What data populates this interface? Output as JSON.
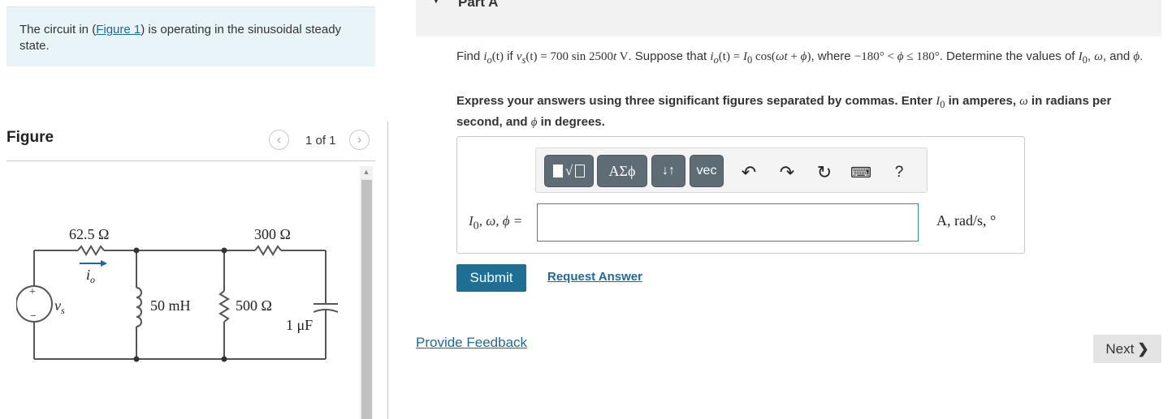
{
  "intro": {
    "text_before": "The circuit in (",
    "figure_link": "Figure 1",
    "text_after": ") is operating in the sinusoidal steady state."
  },
  "figure": {
    "label": "Figure",
    "pager": "1 of 1",
    "prev_icon": "chevron-left",
    "next_icon": "chevron-right"
  },
  "circuit": {
    "r1": "62.5 Ω",
    "r2": "300 Ω",
    "inductor": "50 mH",
    "r3": "500 Ω",
    "capacitor": "1 μF",
    "source_label": "v",
    "source_sub": "s",
    "current_label": "i",
    "current_sub": "o",
    "plus": "+",
    "minus": "−"
  },
  "part": {
    "title": "Part A"
  },
  "question": {
    "find": "Find ",
    "io": "i",
    "io_sub": "o",
    "t_paren": "(t)",
    "if": " if ",
    "vs": "v",
    "vs_sub": "s",
    "eq_value": " = 700 sin 2500",
    "t": "t",
    "unit": " V",
    "suppose": ". Suppose that ",
    "eq_io": " = ",
    "I0": "I",
    "I0_sub": "0",
    "cos": " cos(",
    "omega_t": "ωt",
    "plus_phi": " + ",
    "phi": "ϕ",
    "close": ")",
    "where": ", where ",
    "range": "−180° < ",
    "range2": " ≤ 180°",
    "determine": ". Determine the values of ",
    "comma1": ", ",
    "omega": "ω",
    "and": ", and ",
    "end": "."
  },
  "instructions": {
    "part1": "Express your answers using three significant figures separated by commas. Enter ",
    "I0": "I",
    "I0_sub": "0",
    "part2": " in amperes, ",
    "omega": "ω",
    "part3": " in radians per second, and ",
    "phi": "ϕ",
    "part4": " in degrees."
  },
  "toolbar": {
    "greek": "ΑΣϕ",
    "subsup": "↓↑",
    "vec": "vec",
    "undo_icon": "undo",
    "redo_icon": "redo",
    "reset_icon": "reset",
    "keyboard_icon": "keyboard",
    "help": "?"
  },
  "answer": {
    "label_I": "I",
    "label_sub": "0",
    "label_rest": ", ω, ϕ =",
    "value": "",
    "units": "A, rad/s, °"
  },
  "actions": {
    "submit": "Submit",
    "request_answer": "Request Answer",
    "provide_feedback": "Provide Feedback",
    "next": "Next",
    "next_icon": "chevron-right"
  },
  "colors": {
    "intro_bg": "#e8f4f7",
    "link": "#1a6b9a",
    "submit_bg": "#1f6f94",
    "toolbar_btn": "#5e6c75",
    "input_border": "#2e8ba7"
  }
}
